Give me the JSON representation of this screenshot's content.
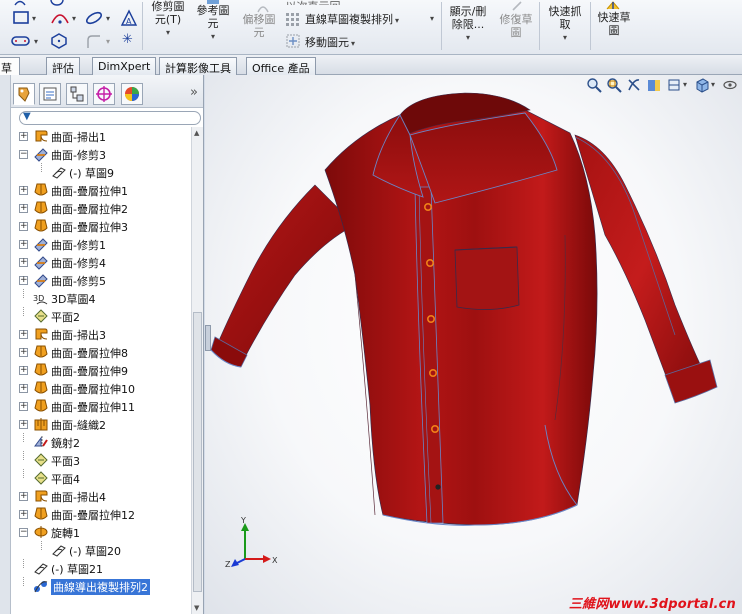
{
  "ribbon": {
    "trim_label_line1": "修剪圖",
    "trim_label_line2": "元(T)",
    "reference_label_line1": "參考圖",
    "reference_label_line2": "元",
    "offset_label_line1": "偏移圖",
    "offset_label_line2": "元",
    "linear_pattern_label": "直線草圖複製排列",
    "move_entities_label": "移動圖元",
    "display_delete_label_line1": "顯示/刪",
    "display_delete_label_line2": "除限...",
    "repair_sketch_label_line1": "修復草",
    "repair_sketch_label_line2": "圖",
    "quick_snap_label_line1": "快速抓",
    "quick_snap_label_line2": "取",
    "rapid_sketch_label_line1": "快速草",
    "rapid_sketch_label_line2": "圖",
    "top_cut_text": "以次直示回"
  },
  "tabs": {
    "partial": "草圖",
    "items": [
      "評估",
      "DimXpert",
      "計算影像工具",
      "Office 產品"
    ]
  },
  "feature_tree": [
    {
      "label": "曲面-掃出1",
      "icon": "sweep-icon",
      "indent": 0,
      "expand": "+"
    },
    {
      "label": "曲面-修剪3",
      "icon": "trim-surface-icon",
      "indent": 0,
      "expand": "−"
    },
    {
      "label": "(-) 草圖9",
      "icon": "sketch-icon",
      "indent": 1,
      "expand": ""
    },
    {
      "label": "曲面-疊層拉伸1",
      "icon": "loft-icon",
      "indent": 0,
      "expand": "+"
    },
    {
      "label": "曲面-疊層拉伸2",
      "icon": "loft-icon",
      "indent": 0,
      "expand": "+"
    },
    {
      "label": "曲面-疊層拉伸3",
      "icon": "loft-icon",
      "indent": 0,
      "expand": "+"
    },
    {
      "label": "曲面-修剪1",
      "icon": "trim-surface-icon",
      "indent": 0,
      "expand": "+"
    },
    {
      "label": "曲面-修剪4",
      "icon": "trim-surface-icon",
      "indent": 0,
      "expand": "+"
    },
    {
      "label": "曲面-修剪5",
      "icon": "trim-surface-icon",
      "indent": 0,
      "expand": "+"
    },
    {
      "label": "3D草圖4",
      "icon": "3d-sketch-icon",
      "indent": 0,
      "expand": ""
    },
    {
      "label": "平面2",
      "icon": "plane-icon",
      "indent": 0,
      "expand": ""
    },
    {
      "label": "曲面-掃出3",
      "icon": "sweep-icon",
      "indent": 0,
      "expand": "+"
    },
    {
      "label": "曲面-疊層拉伸8",
      "icon": "loft-icon",
      "indent": 0,
      "expand": "+"
    },
    {
      "label": "曲面-疊層拉伸9",
      "icon": "loft-icon",
      "indent": 0,
      "expand": "+"
    },
    {
      "label": "曲面-疊層拉伸10",
      "icon": "loft-icon",
      "indent": 0,
      "expand": "+"
    },
    {
      "label": "曲面-疊層拉伸11",
      "icon": "loft-icon",
      "indent": 0,
      "expand": "+"
    },
    {
      "label": "曲面-縫織2",
      "icon": "knit-icon",
      "indent": 0,
      "expand": "+"
    },
    {
      "label": "鏡射2",
      "icon": "mirror-icon",
      "indent": 0,
      "expand": ""
    },
    {
      "label": "平面3",
      "icon": "plane-icon",
      "indent": 0,
      "expand": ""
    },
    {
      "label": "平面4",
      "icon": "plane-icon",
      "indent": 0,
      "expand": ""
    },
    {
      "label": "曲面-掃出4",
      "icon": "sweep-icon",
      "indent": 0,
      "expand": "+"
    },
    {
      "label": "曲面-疊層拉伸12",
      "icon": "loft-icon",
      "indent": 0,
      "expand": "+"
    },
    {
      "label": "旋轉1",
      "icon": "revolve-icon",
      "indent": 0,
      "expand": "−"
    },
    {
      "label": "(-) 草圖20",
      "icon": "sketch-icon",
      "indent": 1,
      "expand": ""
    },
    {
      "label": "(-) 草圖21",
      "icon": "sketch-icon",
      "indent": 0,
      "expand": ""
    },
    {
      "label": "曲線導出複製排列2",
      "icon": "curve-pattern-icon",
      "indent": 0,
      "expand": "",
      "selected": true
    }
  ],
  "triad": {
    "x": "X",
    "y": "Y",
    "z": "Z"
  },
  "watermark": "三維网www.3dportal.cn",
  "colors": {
    "shirt": "#8e0c0c",
    "shirt_light": "#b81818",
    "button": "#f08018",
    "selection": "#3875d7"
  }
}
